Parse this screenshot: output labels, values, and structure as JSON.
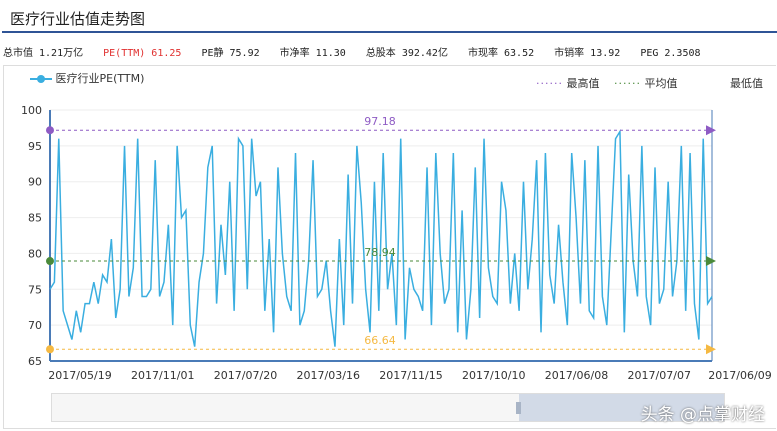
{
  "title": "医疗行业估值走势图",
  "stats": [
    "总市值 1.21万亿",
    "PE(TTM) 61.25",
    "PE静 75.92",
    "市净率 11.30",
    "总股本 392.42亿",
    "市现率 63.52",
    "市销率 13.92",
    "PEG 2.3508"
  ],
  "legend": {
    "series": "医疗行业PE(TTM)",
    "max": "最高值",
    "avg": "平均值",
    "min": "最低值"
  },
  "watermark": "头条 @点掌财经",
  "colors": {
    "line": "#3aaee0",
    "max": "#8e5bc4",
    "avg": "#4a8a3a",
    "min": "#f5b942"
  },
  "chart_data": {
    "type": "line",
    "title": "医疗行业估值走势图",
    "ylim": [
      65,
      100
    ],
    "yticks": [
      "65",
      "70",
      "75",
      "80",
      "85",
      "90",
      "95",
      "100"
    ],
    "xticks": [
      "2017/05/19",
      "2017/11/01",
      "2017/07/20",
      "2017/03/16",
      "2017/11/15",
      "2017/10/10",
      "2017/06/08",
      "2017/07/07",
      "2017/06/09"
    ],
    "reference_lines": {
      "max": {
        "value": 97.18,
        "label": "97.18"
      },
      "avg": {
        "value": 78.94,
        "label": "78.94"
      },
      "min": {
        "value": 66.64,
        "label": "66.64"
      }
    },
    "series": [
      {
        "name": "医疗行业PE(TTM)",
        "values": [
          75,
          76,
          96,
          72,
          70,
          68,
          72,
          69,
          73,
          73,
          76,
          73,
          77,
          76,
          82,
          71,
          75,
          95,
          74,
          78,
          96,
          74,
          74,
          75,
          93,
          74,
          76,
          84,
          70,
          95,
          85,
          86,
          70,
          67,
          76,
          80,
          92,
          95,
          73,
          84,
          77,
          90,
          72,
          96,
          95,
          75,
          96,
          88,
          90,
          72,
          82,
          69,
          92,
          80,
          74,
          72,
          94,
          70,
          72,
          79,
          93,
          74,
          75,
          79,
          72,
          67,
          82,
          70,
          91,
          73,
          95,
          87,
          75,
          69,
          90,
          72,
          94,
          75,
          80,
          70,
          96,
          68,
          78,
          75,
          74,
          72,
          92,
          70,
          94,
          80,
          73,
          75,
          94,
          69,
          86,
          68,
          75,
          92,
          71,
          96,
          78,
          74,
          73,
          90,
          86,
          73,
          80,
          72,
          90,
          75,
          82,
          93,
          69,
          94,
          77,
          73,
          84,
          76,
          70,
          94,
          85,
          73,
          93,
          72,
          71,
          95,
          74,
          70,
          83,
          96,
          97,
          69,
          91,
          79,
          74,
          95,
          74,
          70,
          92,
          73,
          75,
          90,
          74,
          79,
          95,
          72,
          94,
          73,
          68,
          96,
          73,
          74
        ]
      }
    ]
  }
}
